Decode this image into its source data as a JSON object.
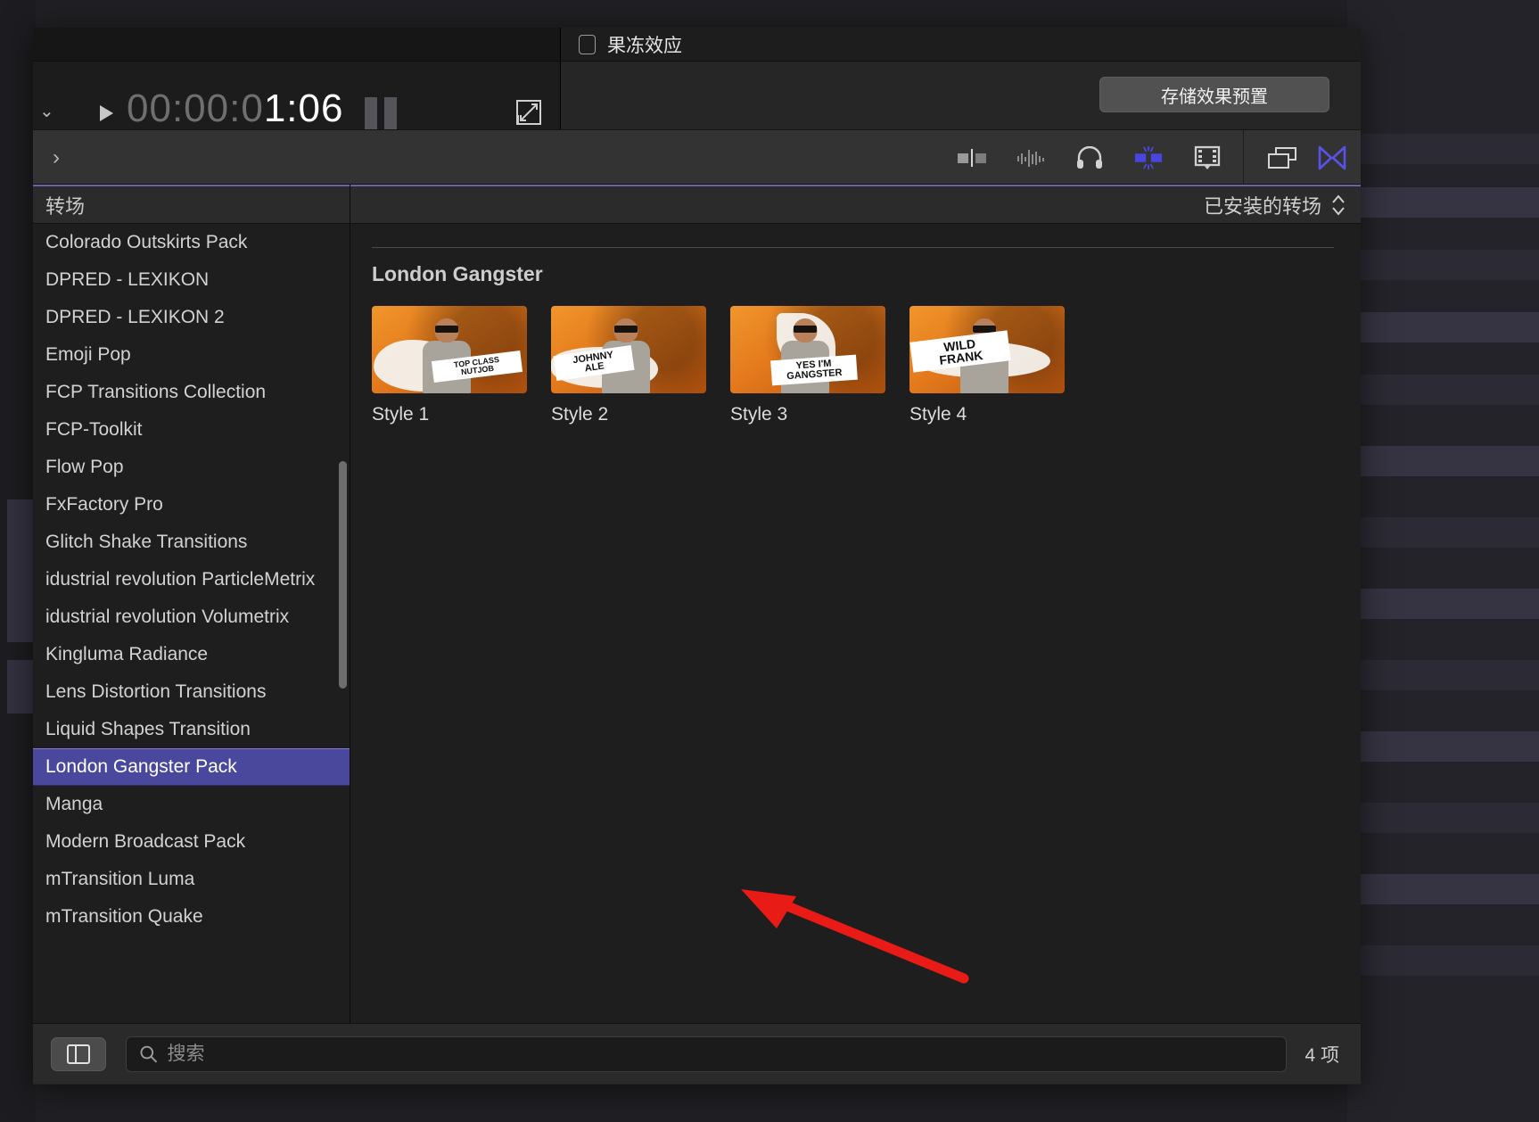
{
  "viewer": {
    "timecode_dim": "00:00:0",
    "timecode_bright": "1:06",
    "play_icon": "play-triangle-icon",
    "expand_icon": "expand-arrows-icon",
    "chevron_icon": "chevron-down-icon"
  },
  "inspector": {
    "rolling_shutter_label": "果冻效应",
    "rolling_shutter_checked": false,
    "save_preset_label": "存储效果预置"
  },
  "toolbar": {
    "disclosure_icon": "chevron-right-icon",
    "icons": [
      {
        "name": "split-clip-icon",
        "label": "视频"
      },
      {
        "name": "audio-waveform-icon",
        "label": "音频"
      },
      {
        "name": "headphones-icon",
        "label": "旁白"
      },
      {
        "name": "transitions-active-icon",
        "label": "转场"
      },
      {
        "name": "filmstrip-icon",
        "label": "标题"
      }
    ],
    "right_icons": [
      {
        "name": "window-overlap-icon",
        "label": "效果"
      },
      {
        "name": "transitions-browser-icon",
        "label": "转场浏览器"
      }
    ],
    "highlight_color": "#e81b16",
    "accent_color": "#4a45e0"
  },
  "sidebar": {
    "header": "转场",
    "items": [
      {
        "label": "Colorado Outskirts Pack",
        "selected": false
      },
      {
        "label": "DPRED - LEXIKON",
        "selected": false
      },
      {
        "label": "DPRED - LEXIKON 2",
        "selected": false
      },
      {
        "label": "Emoji Pop",
        "selected": false
      },
      {
        "label": "FCP Transitions Collection",
        "selected": false
      },
      {
        "label": "FCP-Toolkit",
        "selected": false
      },
      {
        "label": "Flow Pop",
        "selected": false
      },
      {
        "label": "FxFactory Pro",
        "selected": false
      },
      {
        "label": "Glitch Shake Transitions",
        "selected": false
      },
      {
        "label": "idustrial revolution ParticleMetrix",
        "selected": false
      },
      {
        "label": "idustrial revolution Volumetrix",
        "selected": false
      },
      {
        "label": "Kingluma Radiance",
        "selected": false
      },
      {
        "label": "Lens Distortion Transitions",
        "selected": false
      },
      {
        "label": "Liquid Shapes Transition",
        "selected": false
      },
      {
        "label": "London Gangster Pack",
        "selected": true
      },
      {
        "label": "Manga",
        "selected": false
      },
      {
        "label": "Modern Broadcast Pack",
        "selected": false
      },
      {
        "label": "mTransition Luma",
        "selected": false
      },
      {
        "label": "mTransition Quake",
        "selected": false
      }
    ],
    "selection_color": "#4a489c"
  },
  "browser": {
    "filter_label": "已安装的转场",
    "filter_icon": "updown-chevrons-icon",
    "group_title": "London Gangster",
    "thumbnails": [
      {
        "label": "Style 1",
        "tag_text": "TOP CLASS\nNUTJOB"
      },
      {
        "label": "Style 2",
        "tag_text": "JOHNNY\nALE"
      },
      {
        "label": "Style 3",
        "tag_text": "YES I'M\nGANGSTER"
      },
      {
        "label": "Style 4",
        "tag_text": "WILD\nFRANK"
      }
    ]
  },
  "bottom": {
    "sidebar_toggle_icon": "sidebar-panel-icon",
    "search_icon": "search-icon",
    "search_value": "",
    "search_placeholder": "搜索",
    "item_count": "4 项"
  },
  "annotations": {
    "circle_color": "#e81b16",
    "arrow_color": "#e81b16"
  }
}
